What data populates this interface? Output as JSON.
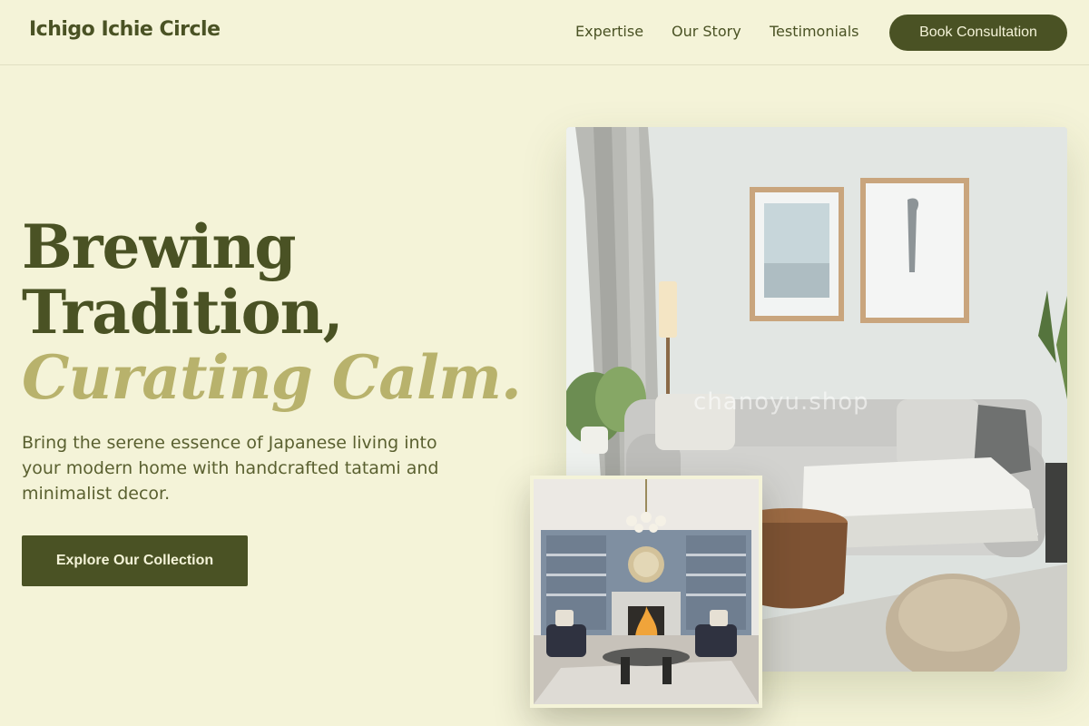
{
  "header": {
    "brand": "Ichigo Ichie Circle",
    "nav": [
      {
        "label": "Expertise"
      },
      {
        "label": "Our Story"
      },
      {
        "label": "Testimonials"
      }
    ],
    "cta_label": "Book Consultation"
  },
  "hero": {
    "title_line1": "Brewing",
    "title_line2": "Tradition,",
    "title_accent": "Curating Calm.",
    "description": "Bring the serene essence of Japanese living into your modern home with handcrafted tatami and minimalist decor.",
    "button_label": "Explore Our Collection"
  },
  "images": {
    "main_watermark": "chanoyu.shop",
    "main_subject": "living-room-photo",
    "inset_subject": "fireplace-lounge-photo"
  },
  "colors": {
    "background": "#f4f3d8",
    "primary": "#4a5224",
    "accent": "#b8b26c"
  }
}
